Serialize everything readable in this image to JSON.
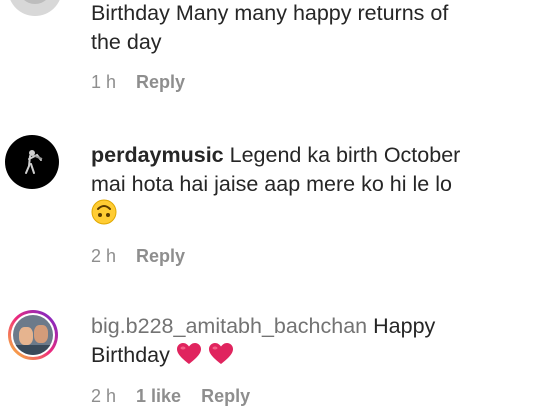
{
  "comments": [
    {
      "username": "",
      "text_line1": "Birthday Many many happy returns of",
      "text_line2": "the day",
      "time": "1 h",
      "reply_label": "Reply"
    },
    {
      "username": "perdaymusic",
      "text_line1": "Legend ka birth October",
      "text_line2": "mai hota hai jaise aap mere ko hi le lo",
      "emoji": "upside-down-face",
      "time": "2 h",
      "reply_label": "Reply"
    },
    {
      "username": "big.b228_amitabh_bachchan",
      "text_line1": "Happy",
      "text_line2": "Birthday",
      "emoji": "red-heart",
      "time": "2 h",
      "likes": "1 like",
      "reply_label": "Reply"
    }
  ],
  "colors": {
    "text": "#262626",
    "meta": "#8e8e8e",
    "heart": "#e0245e",
    "emoji_face": "#ffcc33"
  }
}
